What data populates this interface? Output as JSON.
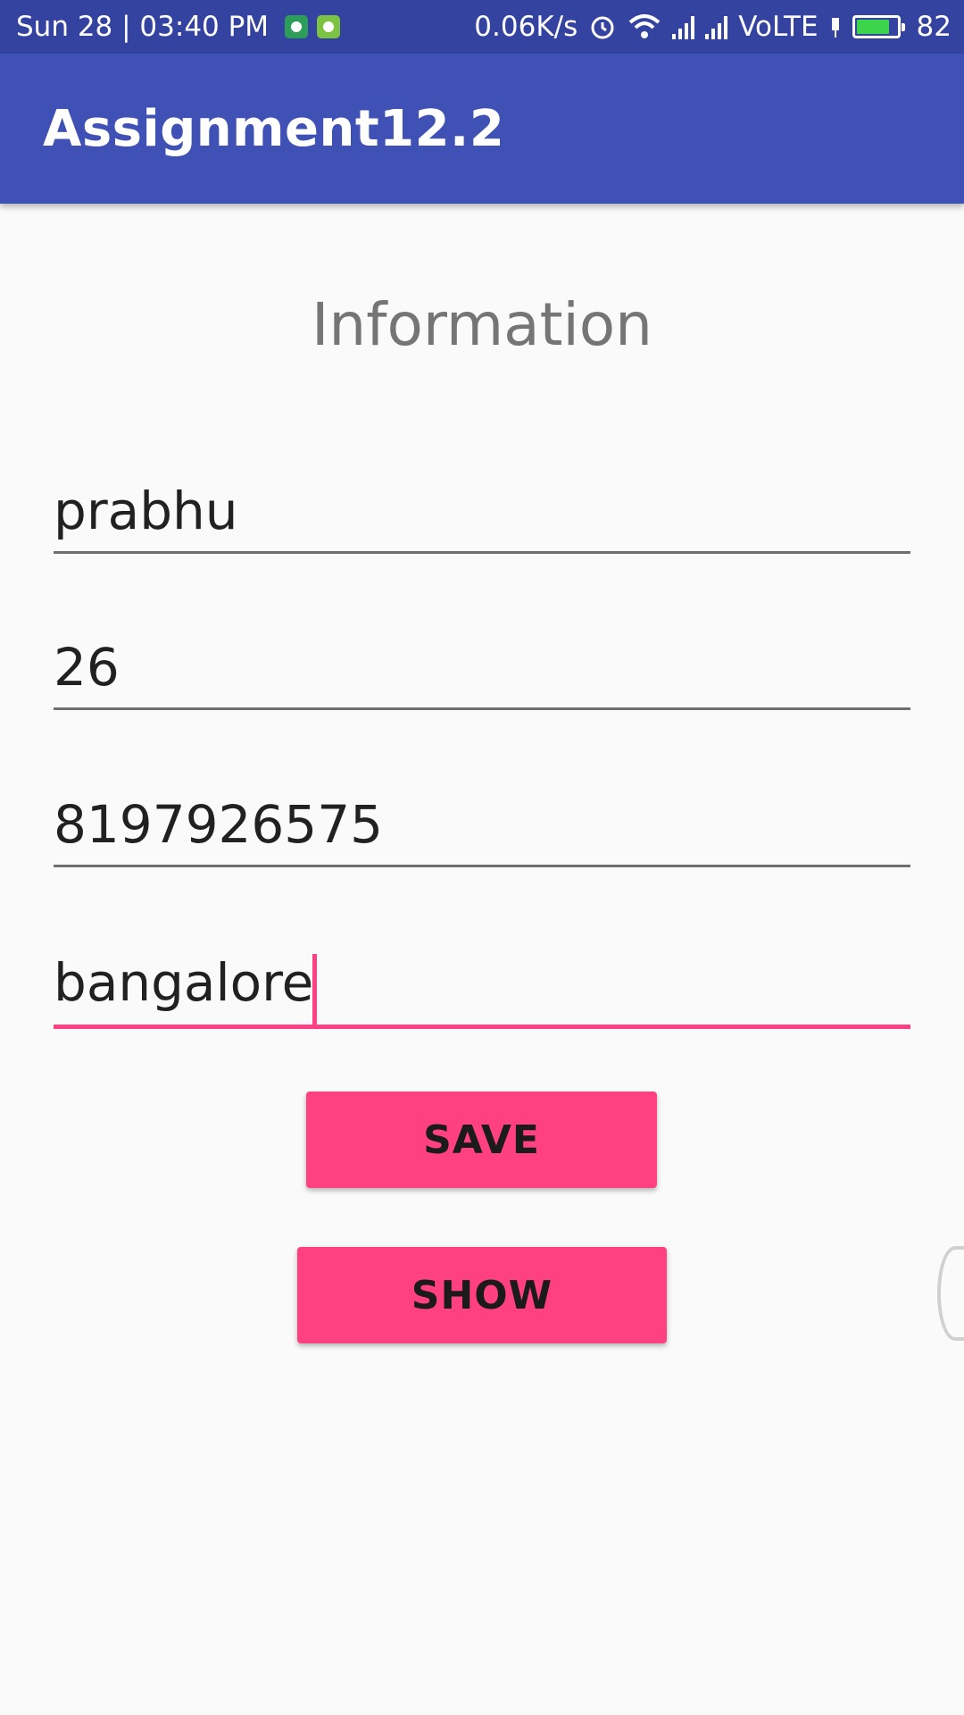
{
  "status_bar": {
    "datetime": "Sun 28 | 03:40 PM",
    "net_speed": "0.06K/s",
    "network": "VoLTE",
    "battery_level": "82"
  },
  "app_bar": {
    "title": "Assignment12.2"
  },
  "form": {
    "heading": "Information",
    "name_value": "prabhu",
    "age_value": "26",
    "phone_value": "8197926575",
    "city_value": "bangalore"
  },
  "buttons": {
    "save_label": "SAVE",
    "show_label": "SHOW"
  },
  "colors": {
    "primary": "#3f51b5",
    "primary_dark": "#3442a0",
    "accent": "#ff4081"
  }
}
